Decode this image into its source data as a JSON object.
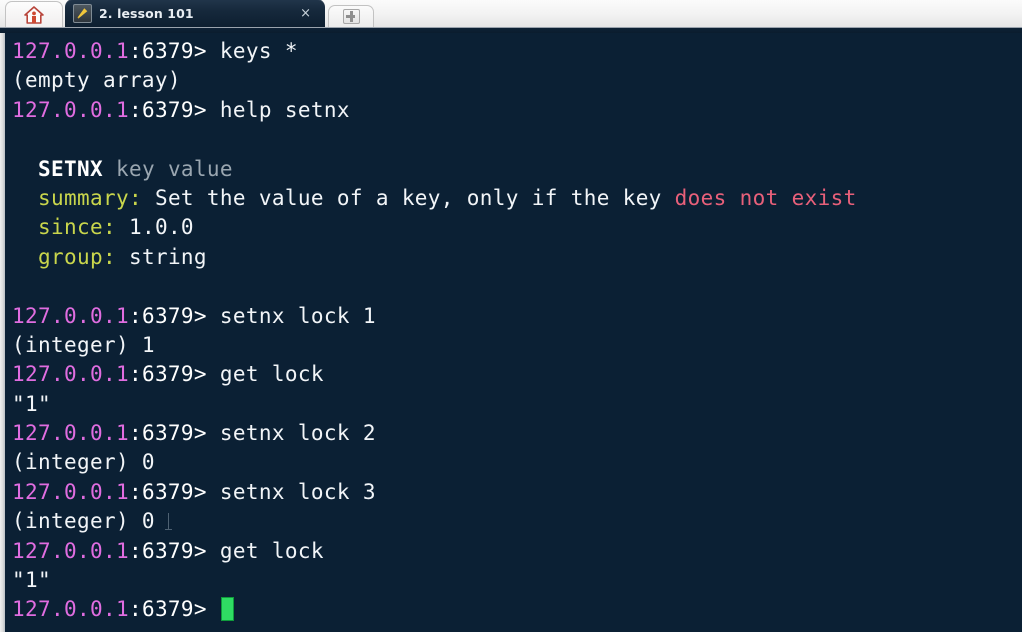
{
  "window": {
    "tabs": [
      {
        "name": "home-tab",
        "icon": "home-icon",
        "label": ""
      },
      {
        "name": "session-tab",
        "icon": "terminal-app-icon",
        "label": "2. lesson 101",
        "close_label": "×",
        "active": true
      }
    ],
    "new_tab_label": "+",
    "new_tab_icon": "plus-icon"
  },
  "terminal": {
    "prompt_host": "127.0.0.1",
    "prompt_port": ":6379>",
    "colors": {
      "background": "#0b2034",
      "host": "#e06de0",
      "text": "#f2f5f8",
      "label": "#c9d64c",
      "arg": "#9aa6b0",
      "highlight": "#e8607a",
      "cursor": "#2fdc63"
    },
    "lines": [
      {
        "type": "prompt",
        "command": "keys *"
      },
      {
        "type": "output",
        "text": "(empty array)"
      },
      {
        "type": "prompt",
        "command": "help setnx"
      },
      {
        "type": "blank",
        "text": ""
      },
      {
        "type": "help-sig",
        "name": "SETNX",
        "args": "key value"
      },
      {
        "type": "help-kv",
        "label": "summary:",
        "text": " Set the value of a key, only if the key ",
        "highlight": "does not exist"
      },
      {
        "type": "help-kv",
        "label": "since:",
        "text": " 1.0.0",
        "highlight": ""
      },
      {
        "type": "help-kv",
        "label": "group:",
        "text": " string",
        "highlight": ""
      },
      {
        "type": "blank",
        "text": ""
      },
      {
        "type": "prompt",
        "command": "setnx lock 1"
      },
      {
        "type": "output",
        "text": "(integer) 1"
      },
      {
        "type": "prompt",
        "command": "get lock"
      },
      {
        "type": "output",
        "text": "\"1\""
      },
      {
        "type": "prompt",
        "command": "setnx lock 2"
      },
      {
        "type": "output",
        "text": "(integer) 0"
      },
      {
        "type": "prompt",
        "command": "setnx lock 3"
      },
      {
        "type": "output",
        "text": "(integer) 0",
        "ibeam": true
      },
      {
        "type": "prompt",
        "command": "get lock"
      },
      {
        "type": "output",
        "text": "\"1\""
      },
      {
        "type": "prompt",
        "command": "",
        "cursor": true
      }
    ]
  }
}
